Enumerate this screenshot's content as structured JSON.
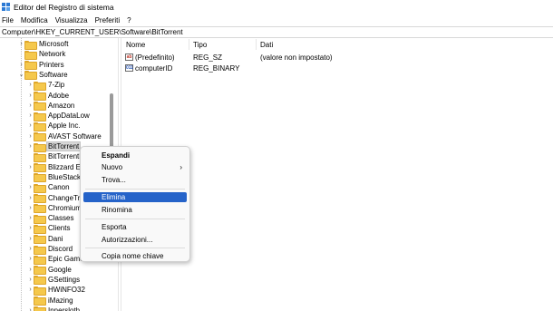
{
  "window": {
    "title": "Editor del Registro di sistema"
  },
  "menubar": [
    "File",
    "Modifica",
    "Visualizza",
    "Preferiti",
    "?"
  ],
  "address": "Computer\\HKEY_CURRENT_USER\\Software\\BitTorrent",
  "tree": {
    "items": [
      {
        "label": "Microsoft",
        "expander": ">",
        "selected": false
      },
      {
        "label": "Network",
        "expander": "",
        "selected": false
      },
      {
        "label": "Printers",
        "expander": ">",
        "selected": false
      },
      {
        "label": "Software",
        "expander": "v",
        "selected": false
      },
      {
        "label": "7-Zip",
        "expander": ">",
        "selected": false
      },
      {
        "label": "Adobe",
        "expander": ">",
        "selected": false
      },
      {
        "label": "Amazon",
        "expander": ">",
        "selected": false
      },
      {
        "label": "AppDataLow",
        "expander": ">",
        "selected": false
      },
      {
        "label": "Apple Inc.",
        "expander": ">",
        "selected": false
      },
      {
        "label": "AVAST Software",
        "expander": ">",
        "selected": false
      },
      {
        "label": "BitTorrent",
        "expander": ">",
        "selected": true
      },
      {
        "label": "BitTorrentP",
        "expander": "",
        "selected": false
      },
      {
        "label": "Blizzard En",
        "expander": ">",
        "selected": false
      },
      {
        "label": "BlueStacks",
        "expander": "",
        "selected": false
      },
      {
        "label": "Canon",
        "expander": ">",
        "selected": false
      },
      {
        "label": "ChangeTra",
        "expander": ">",
        "selected": false
      },
      {
        "label": "Chromium",
        "expander": ">",
        "selected": false
      },
      {
        "label": "Classes",
        "expander": ">",
        "selected": false
      },
      {
        "label": "Clients",
        "expander": ">",
        "selected": false
      },
      {
        "label": "Dani",
        "expander": ">",
        "selected": false
      },
      {
        "label": "Discord",
        "expander": ">",
        "selected": false
      },
      {
        "label": "Epic Game",
        "expander": ">",
        "selected": false
      },
      {
        "label": "Google",
        "expander": ">",
        "selected": false
      },
      {
        "label": "GSettings",
        "expander": ">",
        "selected": false
      },
      {
        "label": "HWiNFO32",
        "expander": ">",
        "selected": false
      },
      {
        "label": "iMazing",
        "expander": "",
        "selected": false
      },
      {
        "label": "Innersloth",
        "expander": ">",
        "selected": false
      }
    ]
  },
  "values": {
    "headers": {
      "name": "Nome",
      "type": "Tipo",
      "data": "Dati"
    },
    "rows": [
      {
        "name": "(Predefinito)",
        "type": "REG_SZ",
        "data": "(valore non impostato)",
        "icon": "string-value-icon",
        "glyph": "ab"
      },
      {
        "name": "computerID",
        "type": "REG_BINARY",
        "data": "",
        "icon": "binary-value-icon",
        "glyph": "011"
      }
    ]
  },
  "context_menu": {
    "expand": "Espandi",
    "new": "Nuovo",
    "new_arrow": "›",
    "find": "Trova...",
    "delete": "Elimina",
    "rename": "Rinomina",
    "export": "Esporta",
    "permissions": "Autorizzazioni...",
    "copy_key_name": "Copia nome chiave",
    "highlighted": "delete"
  },
  "colors": {
    "selection_blue": "#2563c9",
    "folder_yellow": "#f5c84c"
  }
}
